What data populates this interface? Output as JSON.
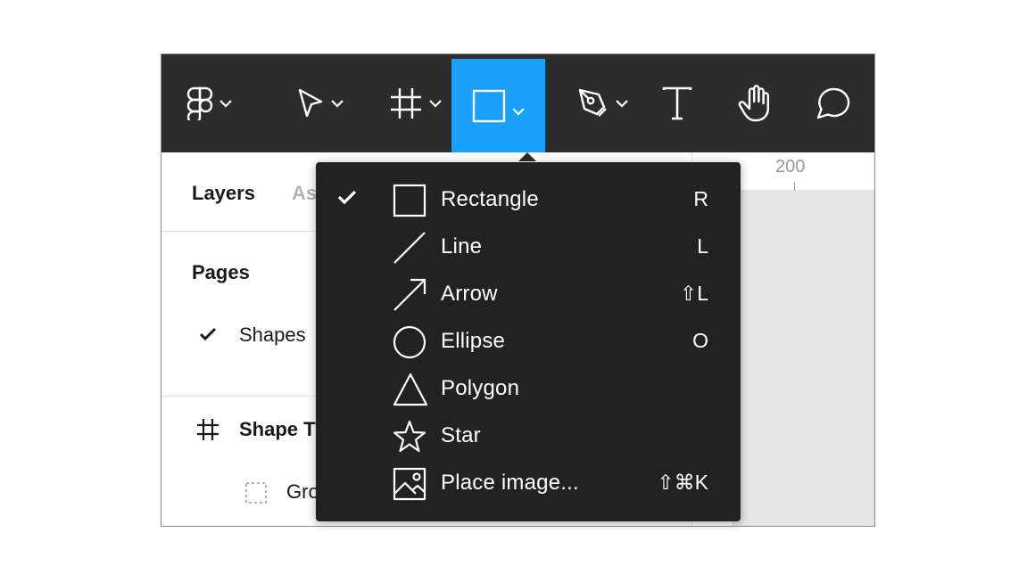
{
  "toolbar": {
    "tools": [
      {
        "name": "main-menu",
        "icon": "figma-logo-icon",
        "has_dropdown": true
      },
      {
        "name": "move-tool",
        "icon": "cursor-arrow-icon",
        "has_dropdown": true
      },
      {
        "name": "frame-tool",
        "icon": "frame-hash-icon",
        "has_dropdown": true
      },
      {
        "name": "shape-tool",
        "icon": "rectangle-icon",
        "has_dropdown": true,
        "active": true
      },
      {
        "name": "pen-tool",
        "icon": "pen-nib-icon",
        "has_dropdown": true
      },
      {
        "name": "text-tool",
        "icon": "text-t-icon",
        "has_dropdown": false
      },
      {
        "name": "hand-tool",
        "icon": "hand-icon",
        "has_dropdown": false
      },
      {
        "name": "comment-tool",
        "icon": "comment-bubble-icon",
        "has_dropdown": false
      }
    ],
    "active_color": "#18a0fb",
    "background": "#2c2c2c"
  },
  "left_panel": {
    "tab_layers": "Layers",
    "tab_assets_partial": "As",
    "pages_heading": "Pages",
    "current_page": "Shapes",
    "frame_layer": "Shape T",
    "group_layer": "Gro"
  },
  "ruler": {
    "label": "200"
  },
  "shape_menu": {
    "items": [
      {
        "label": "Rectangle",
        "shortcut": "R",
        "icon": "rectangle-icon",
        "checked": true
      },
      {
        "label": "Line",
        "shortcut": "L",
        "icon": "line-icon",
        "checked": false
      },
      {
        "label": "Arrow",
        "shortcut": "⇧L",
        "icon": "arrow-icon",
        "checked": false
      },
      {
        "label": "Ellipse",
        "shortcut": "O",
        "icon": "ellipse-icon",
        "checked": false
      },
      {
        "label": "Polygon",
        "shortcut": "",
        "icon": "polygon-icon",
        "checked": false
      },
      {
        "label": "Star",
        "shortcut": "",
        "icon": "star-icon",
        "checked": false
      },
      {
        "label": "Place image...",
        "shortcut": "⇧⌘K",
        "icon": "image-icon",
        "checked": false
      }
    ]
  }
}
